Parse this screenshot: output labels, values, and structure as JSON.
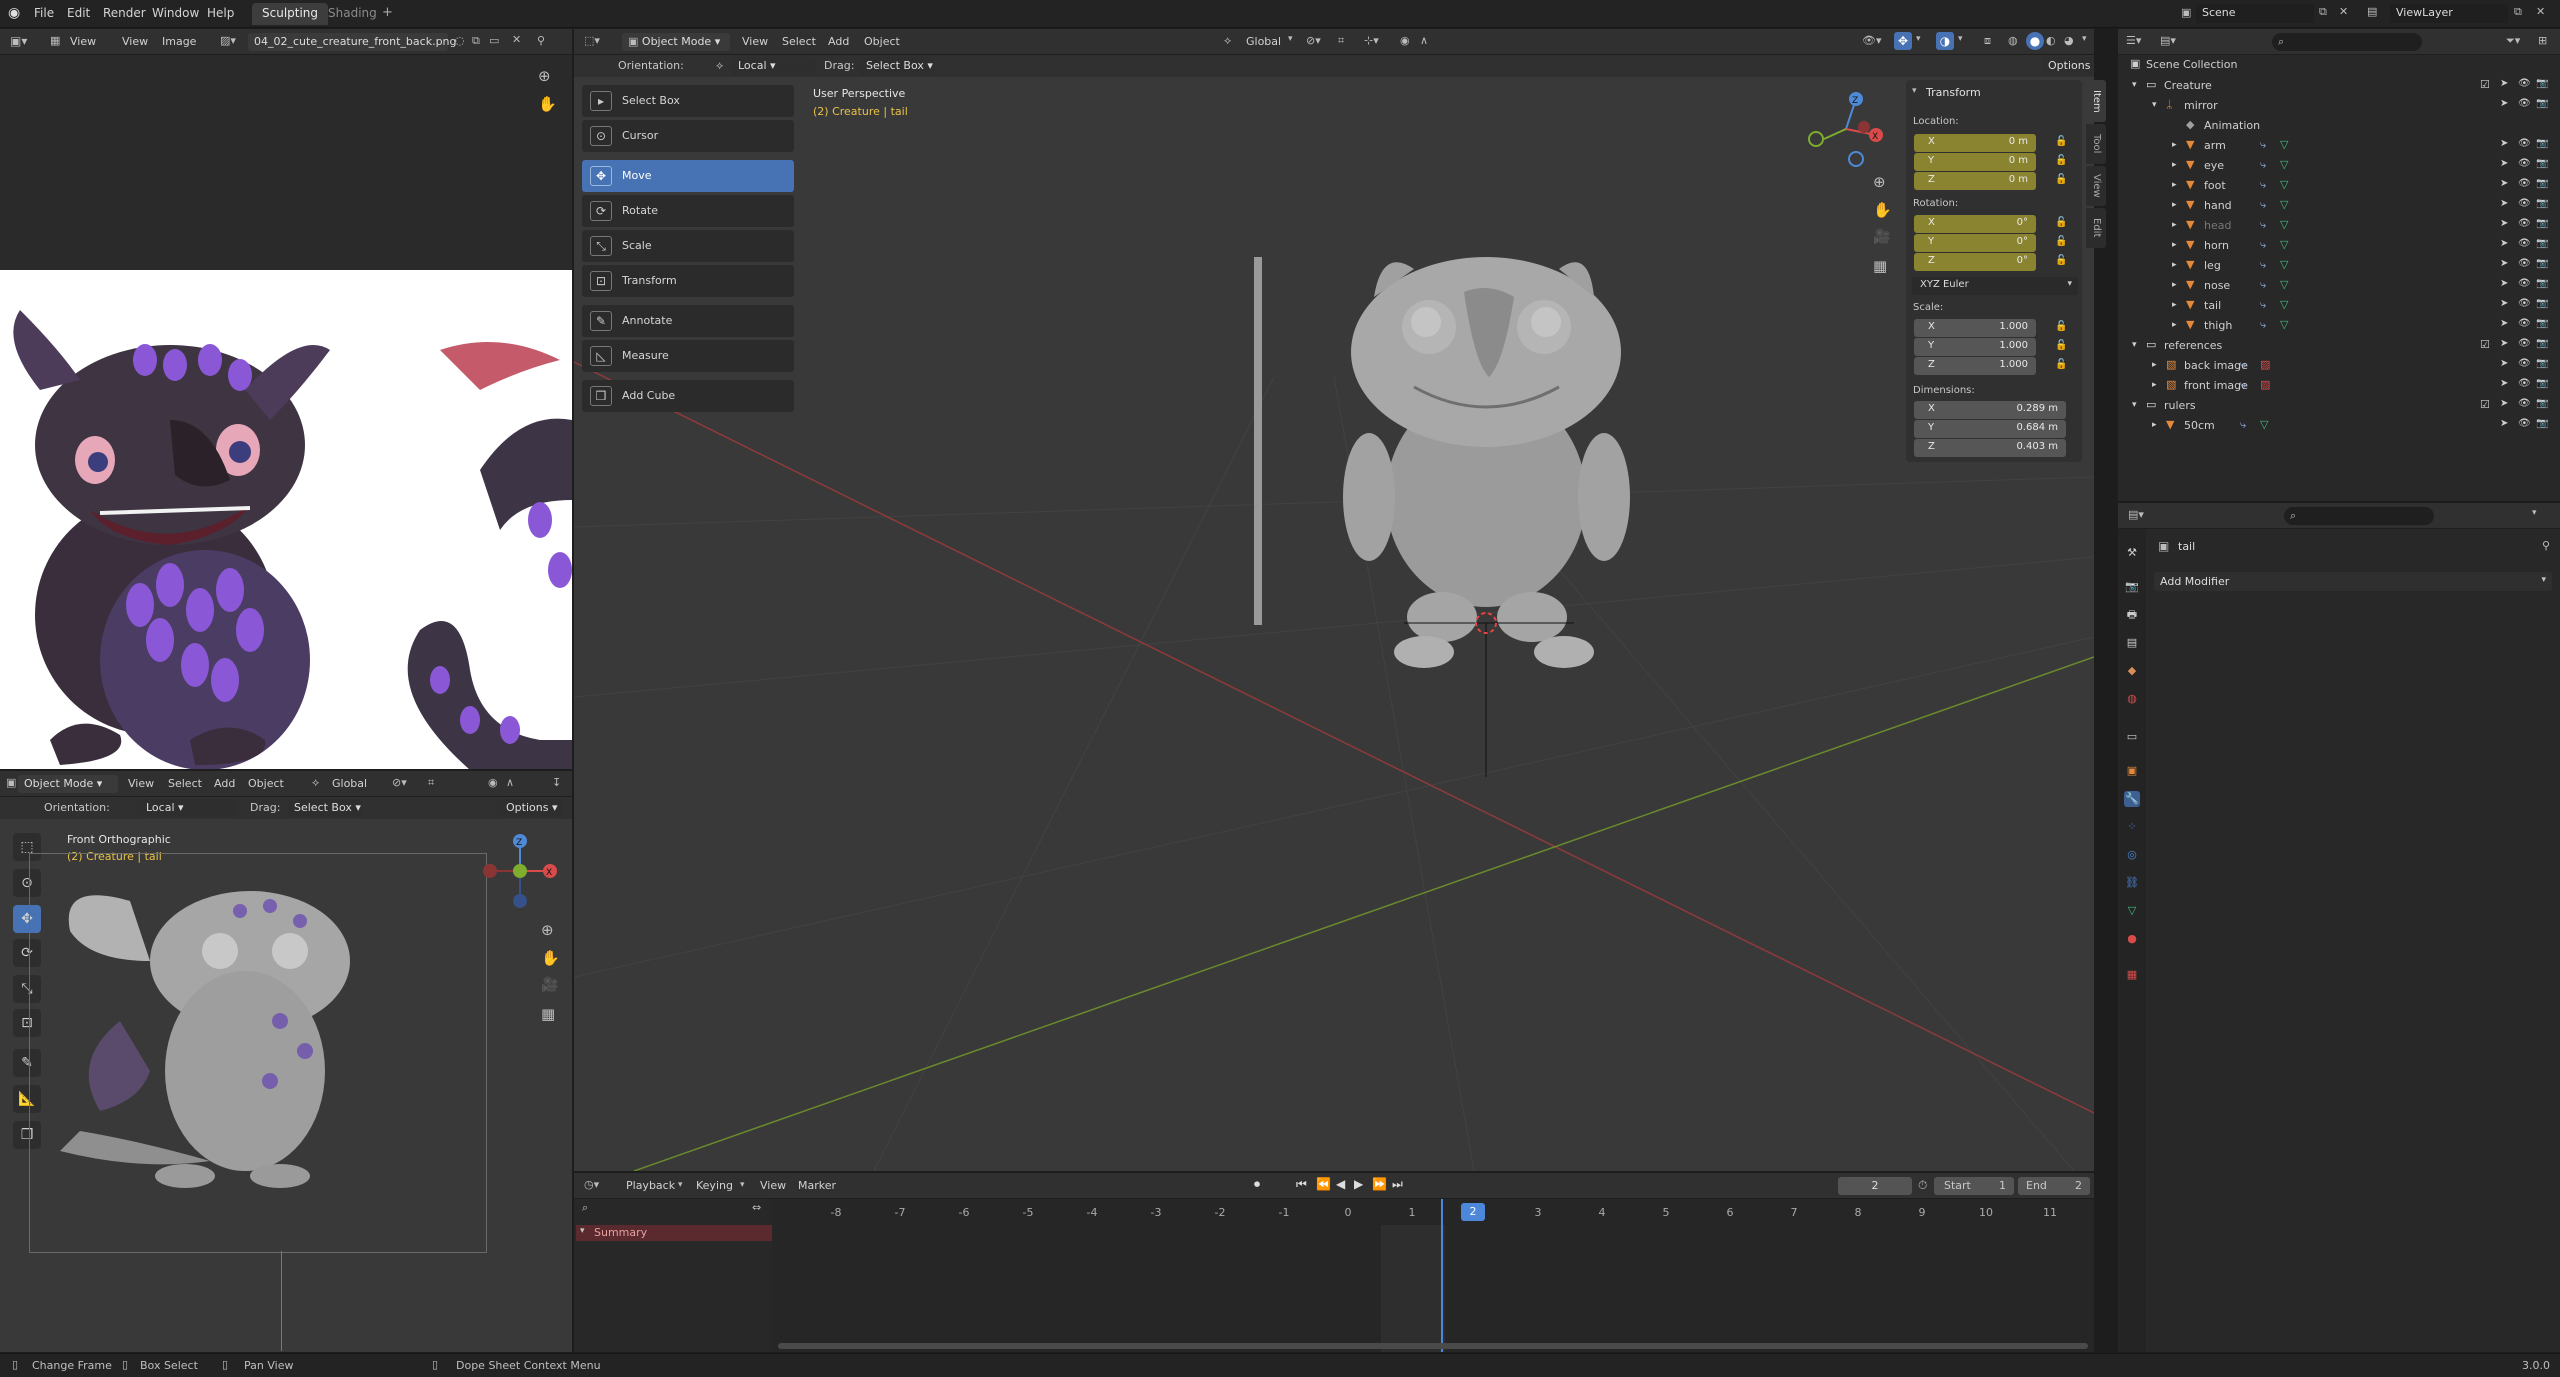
{
  "topbar": {
    "menus": [
      "File",
      "Edit",
      "Render",
      "Window",
      "Help"
    ],
    "tabs": [
      "Sculpting",
      "Shading"
    ],
    "add_tab": "+",
    "scene": "Scene",
    "view_layer": "ViewLayer"
  },
  "image_editor": {
    "view": "View",
    "image": "Image",
    "filename": "04_02_cute_creature_front_back.png"
  },
  "viewport": {
    "mode": "Object Mode",
    "menus": [
      "View",
      "Select",
      "Add",
      "Object"
    ],
    "transform_orientation": "Global",
    "orientation_label": "Orientation:",
    "orientation_value": "Local",
    "drag_label": "Drag:",
    "drag_value": "Select Box",
    "options": "Options",
    "perspective": "User Perspective",
    "active": "(2) Creature | tail",
    "tools": [
      "Select Box",
      "Cursor",
      "Move",
      "Rotate",
      "Scale",
      "Transform",
      "Annotate",
      "Measure",
      "Add Cube"
    ],
    "active_tool": "Move",
    "side_tabs": [
      "Item",
      "Tool",
      "View",
      "Edit"
    ]
  },
  "npanel": {
    "title": "Transform",
    "location_label": "Location:",
    "location": [
      {
        "axis": "X",
        "value": "0 m"
      },
      {
        "axis": "Y",
        "value": "0 m"
      },
      {
        "axis": "Z",
        "value": "0 m"
      }
    ],
    "rotation_label": "Rotation:",
    "rotation": [
      {
        "axis": "X",
        "value": "0°"
      },
      {
        "axis": "Y",
        "value": "0°"
      },
      {
        "axis": "Z",
        "value": "0°"
      }
    ],
    "rotation_mode": "XYZ Euler",
    "scale_label": "Scale:",
    "scale": [
      {
        "axis": "X",
        "value": "1.000"
      },
      {
        "axis": "Y",
        "value": "1.000"
      },
      {
        "axis": "Z",
        "value": "1.000"
      }
    ],
    "dimensions_label": "Dimensions:",
    "dimensions": [
      {
        "axis": "X",
        "value": "0.289 m"
      },
      {
        "axis": "Y",
        "value": "0.684 m"
      },
      {
        "axis": "Z",
        "value": "0.403 m"
      }
    ]
  },
  "viewport2": {
    "mode": "Object Mode",
    "menus": [
      "View",
      "Select",
      "Add",
      "Object"
    ],
    "transform_orientation": "Global",
    "orientation_label": "Orientation:",
    "orientation_value": "Local",
    "drag_label": "Drag:",
    "drag_value": "Select Box",
    "options": "Options",
    "perspective": "Front Orthographic",
    "active": "(2) Creature | tail"
  },
  "outliner": {
    "root": "Scene Collection",
    "rows": [
      {
        "name": "Creature",
        "kind": "collection"
      },
      {
        "name": "mirror",
        "kind": "armature"
      },
      {
        "name": "Animation",
        "kind": "anim"
      },
      {
        "name": "arm",
        "kind": "mesh"
      },
      {
        "name": "eye",
        "kind": "mesh"
      },
      {
        "name": "foot",
        "kind": "mesh"
      },
      {
        "name": "hand",
        "kind": "mesh"
      },
      {
        "name": "head",
        "kind": "mesh"
      },
      {
        "name": "horn",
        "kind": "mesh"
      },
      {
        "name": "leg",
        "kind": "mesh"
      },
      {
        "name": "nose",
        "kind": "mesh"
      },
      {
        "name": "tail",
        "kind": "mesh"
      },
      {
        "name": "thigh",
        "kind": "mesh"
      },
      {
        "name": "references",
        "kind": "collection"
      },
      {
        "name": "back image",
        "kind": "image"
      },
      {
        "name": "front image",
        "kind": "image"
      },
      {
        "name": "rulers",
        "kind": "collection"
      },
      {
        "name": "50cm",
        "kind": "mesh"
      }
    ]
  },
  "properties": {
    "object": "tail",
    "add_modifier": "Add Modifier"
  },
  "timeline": {
    "menus": [
      "Playback",
      "Keying",
      "View",
      "Marker"
    ],
    "current_frame": "2",
    "start_label": "Start",
    "start": "1",
    "end_label": "End",
    "end": "2",
    "channel": "Summary",
    "frames": [
      "-8",
      "-7",
      "-6",
      "-5",
      "-4",
      "-3",
      "-2",
      "-1",
      "0",
      "1",
      "2",
      "3",
      "4",
      "5",
      "6",
      "7",
      "8",
      "9",
      "10",
      "11"
    ]
  },
  "statusbar": {
    "items": [
      "Change Frame",
      "Box Select",
      "Pan View",
      "Dope Sheet Context Menu"
    ],
    "version": "3.0.0"
  }
}
